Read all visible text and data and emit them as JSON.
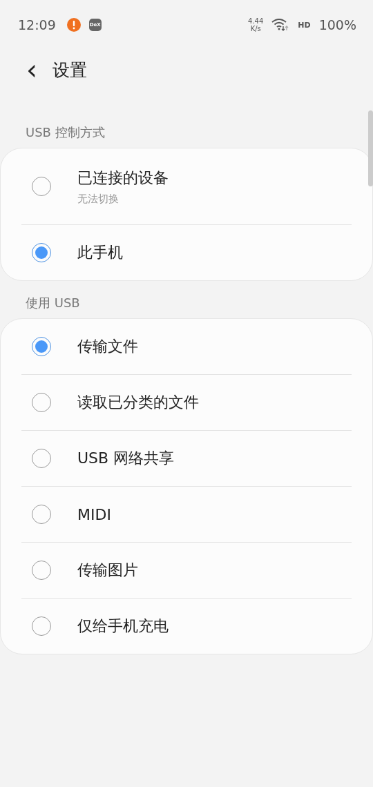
{
  "status_bar": {
    "time": "12:09",
    "dex_label": "DeX",
    "net_speed": "4.44",
    "net_unit": "K/s",
    "hd": "HD",
    "battery": "100%"
  },
  "header": {
    "back": "‹",
    "title": "设置"
  },
  "sections": [
    {
      "title": "USB 控制方式",
      "items": [
        {
          "label": "已连接的设备",
          "subtitle": "无法切换",
          "selected": false
        },
        {
          "label": "此手机",
          "selected": true
        }
      ]
    },
    {
      "title": "使用 USB",
      "items": [
        {
          "label": "传输文件",
          "selected": true
        },
        {
          "label": "读取已分类的文件",
          "selected": false
        },
        {
          "label": "USB 网络共享",
          "selected": false
        },
        {
          "label": "MIDI",
          "selected": false
        },
        {
          "label": "传输图片",
          "selected": false
        },
        {
          "label": "仅给手机充电",
          "selected": false
        }
      ]
    }
  ]
}
